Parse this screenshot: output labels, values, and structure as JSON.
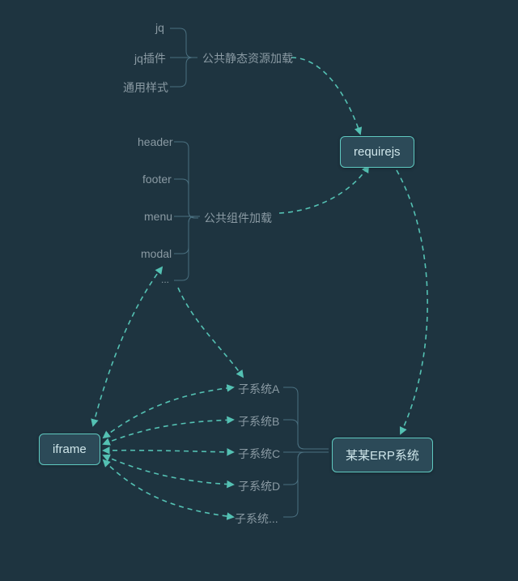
{
  "nodes": {
    "iframe": {
      "text": "iframe"
    },
    "requirejs": {
      "text": "requirejs"
    },
    "erp": {
      "text": "某某ERP系统"
    }
  },
  "labels": {
    "static_group": {
      "title": "公共静态资源加载",
      "items": [
        "jq",
        "jq插件",
        "通用样式"
      ]
    },
    "component_group": {
      "title": "公共组件加载",
      "items": [
        "header",
        "footer",
        "menu",
        "modal",
        "..."
      ]
    },
    "subsystems": [
      "子系统A",
      "子系统B",
      "子系统C",
      "子系统D",
      "子系统..."
    ]
  }
}
